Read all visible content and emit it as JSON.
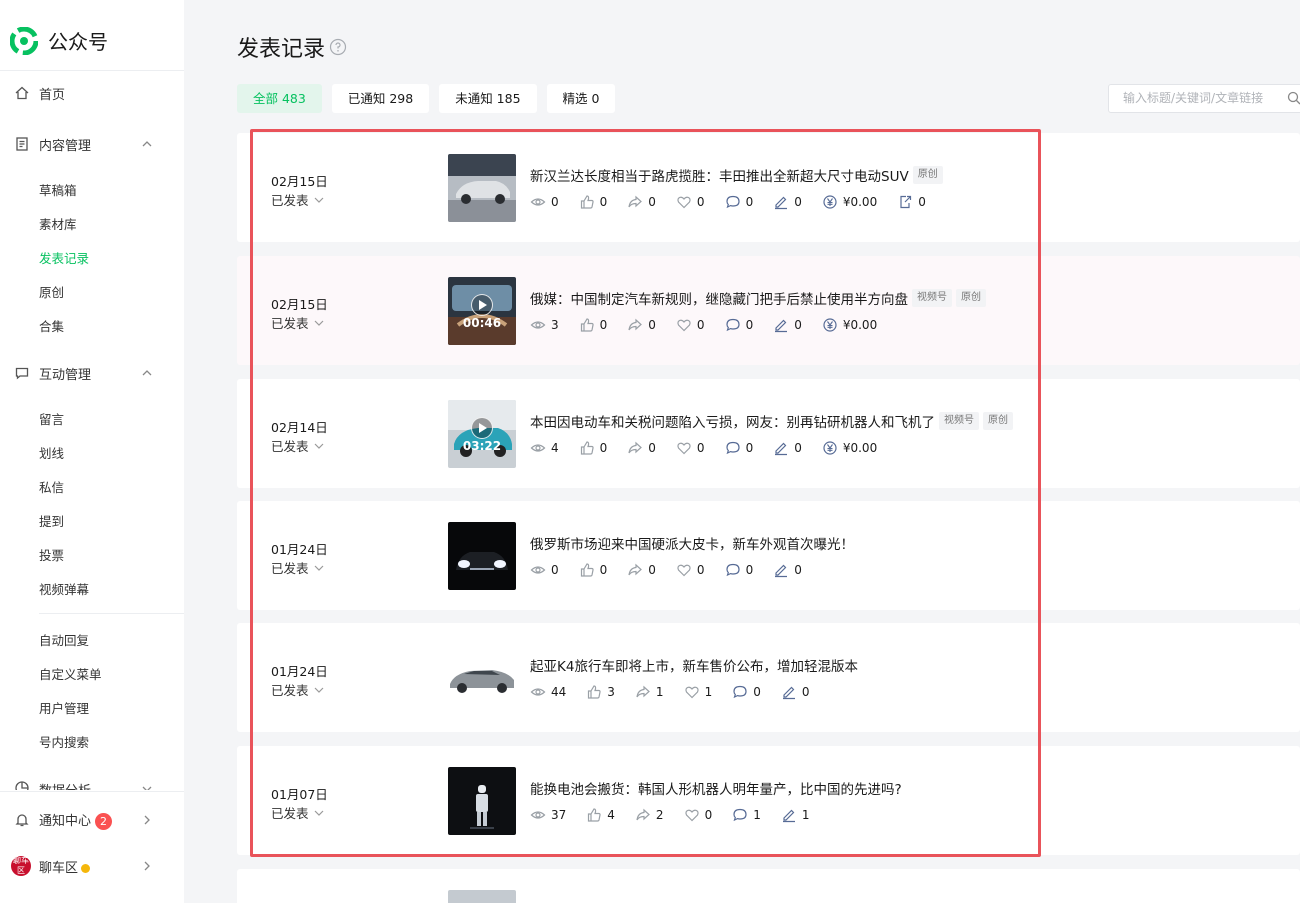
{
  "app": {
    "name": "公众号"
  },
  "sidebar": {
    "home": "首页",
    "content_mgmt": "内容管理",
    "content_items": [
      "草稿箱",
      "素材库",
      "发表记录",
      "原创",
      "合集"
    ],
    "interaction_mgmt": "互动管理",
    "interaction_items": [
      "留言",
      "划线",
      "私信",
      "提到",
      "投票",
      "视频弹幕"
    ],
    "other_items": [
      "自动回复",
      "自定义菜单",
      "用户管理",
      "号内搜索"
    ],
    "data_analysis": "数据分析",
    "notifications": {
      "label": "通知中心",
      "count": "2"
    },
    "account": {
      "name": "聊车区",
      "avatar_text": "聊车区"
    }
  },
  "page": {
    "title": "发表记录"
  },
  "tabs": [
    {
      "label": "全部 483"
    },
    {
      "label": "已通知 298"
    },
    {
      "label": "未通知 185"
    },
    {
      "label": "精选 0"
    }
  ],
  "search": {
    "placeholder": "输入标题/关键词/文章链接"
  },
  "articles": [
    {
      "date": "02月15日",
      "status": "已发表",
      "title": "新汉兰达长度相当于路虎揽胜：丰田推出全新超大尺寸电动SUV",
      "tags": [
        "原创"
      ],
      "duration": "",
      "reads": "0",
      "likes": "0",
      "shares": "0",
      "wows": "0",
      "comments": "0",
      "underlines": "0",
      "reward": "¥0.00",
      "jumps": "0"
    },
    {
      "date": "02月15日",
      "status": "已发表",
      "title": "俄媒：中国制定汽车新规则，继隐藏门把手后禁止使用半方向盘",
      "tags": [
        "视频号",
        "原创"
      ],
      "duration": "00:46",
      "reads": "3",
      "likes": "0",
      "shares": "0",
      "wows": "0",
      "comments": "0",
      "underlines": "0",
      "reward": "¥0.00"
    },
    {
      "date": "02月14日",
      "status": "已发表",
      "title": "本田因电动车和关税问题陷入亏损，网友：别再钻研机器人和飞机了",
      "tags": [
        "视频号",
        "原创"
      ],
      "duration": "03:22",
      "reads": "4",
      "likes": "0",
      "shares": "0",
      "wows": "0",
      "comments": "0",
      "underlines": "0",
      "reward": "¥0.00"
    },
    {
      "date": "01月24日",
      "status": "已发表",
      "title": "俄罗斯市场迎来中国硬派大皮卡，新车外观首次曝光！",
      "tags": [],
      "duration": "",
      "reads": "0",
      "likes": "0",
      "shares": "0",
      "wows": "0",
      "comments": "0",
      "underlines": "0"
    },
    {
      "date": "01月24日",
      "status": "已发表",
      "title": "起亚K4旅行车即将上市，新车售价公布，增加轻混版本",
      "tags": [],
      "duration": "",
      "reads": "44",
      "likes": "3",
      "shares": "1",
      "wows": "1",
      "comments": "0",
      "underlines": "0"
    },
    {
      "date": "01月07日",
      "status": "已发表",
      "title": "能换电池会搬货：韩国人形机器人明年量产，比中国的先进吗?",
      "tags": [],
      "duration": "",
      "reads": "37",
      "likes": "4",
      "shares": "2",
      "wows": "0",
      "comments": "1",
      "underlines": "1"
    }
  ],
  "colors": {
    "accent": "#07c160",
    "highlight_border": "#e9535a",
    "badge": "#fa5151",
    "stat_icon_blue": "#576b95"
  }
}
